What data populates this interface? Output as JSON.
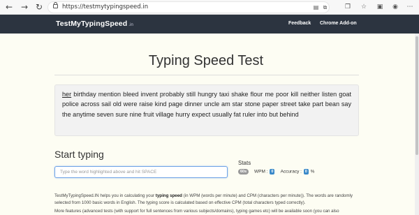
{
  "browser": {
    "url": "https://testmytypingspeed.in",
    "icons": [
      "back-icon",
      "forward-icon",
      "refresh-icon",
      "lock-icon",
      "reader-icon",
      "extension-icon",
      "collections-icon",
      "favorites-icon",
      "tab-icon",
      "profile-icon",
      "more-icon"
    ]
  },
  "navbar": {
    "brand": "TestMyTypingSpeed",
    "brand_suffix": ".in",
    "links": [
      "Feedback",
      "Chrome Add-on"
    ]
  },
  "main": {
    "title": "Typing Speed Test",
    "highlighted_word": "her",
    "words": "birthday mention bleed invent probably still hungry taxi shake flour me poor kill neither listen goat police across sail old were raise kind page dinner uncle am star stone paper street take part bean say the anytime seven sure nine fruit village hurry expect usually fat ruler into but behind",
    "start_title": "Start typing",
    "input_placeholder": "Type the word highlighted above and hit SPACE",
    "stats": {
      "title": "Stats",
      "timer": "60s",
      "wpm_label": "WPM :",
      "wpm_value": "0",
      "accuracy_label": "Accuracy :",
      "accuracy_value": "0",
      "accuracy_unit": "%"
    },
    "description": {
      "p1_a": "TestMyTypingSpeed.IN helps you in calculating your ",
      "p1_bold": "typing speed",
      "p1_b": " (in WPM (words per minute) and CPM (characters per minute)). The words are randomly selected from 1000 basic words in English. The typing score is calculated based on effective CPM (total characters typed correctly).",
      "p2": "More features (advanced tests (with support for full sentences from various subjects/domains), typing games etc) will be available soon (you can also"
    }
  }
}
